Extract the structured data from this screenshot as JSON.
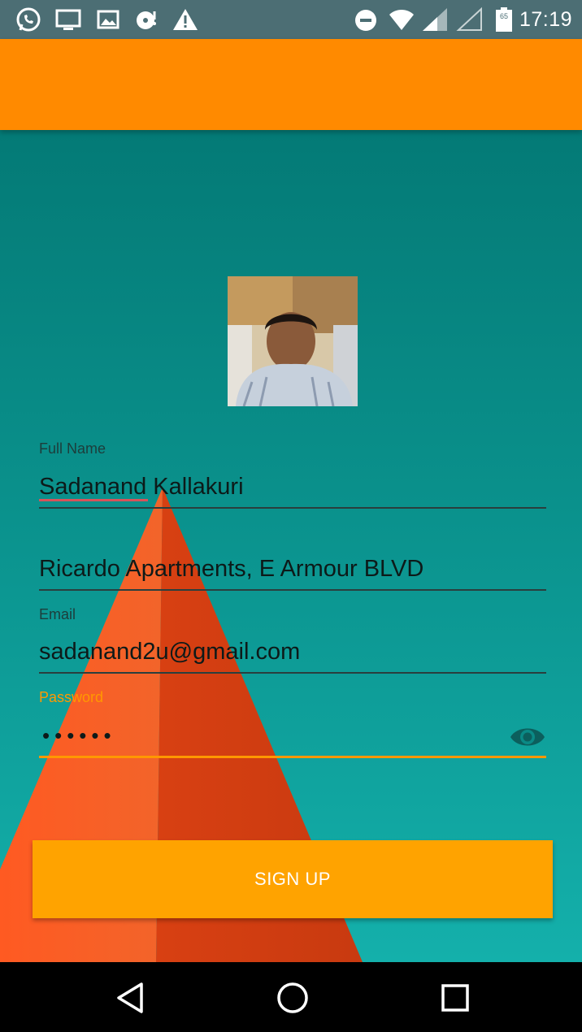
{
  "status_bar": {
    "time": "17:19",
    "left_icons": [
      "whatsapp-icon",
      "cast-display-icon",
      "image-icon",
      "sync-disc-icon",
      "warning-icon"
    ],
    "right_icons": [
      "do-not-disturb-icon",
      "wifi-icon",
      "cell-signal-icon",
      "cell-signal-empty-icon",
      "battery-icon"
    ],
    "battery_level": "65"
  },
  "form": {
    "full_name": {
      "label": "Full Name",
      "value": "Sadanand Kallakuri"
    },
    "address": {
      "value": "Ricardo Apartments, E Armour BLVD"
    },
    "email": {
      "label": "Email",
      "value": "sadanand2u@gmail.com"
    },
    "password": {
      "label": "Password",
      "value": "••••••"
    },
    "signup_label": "SIGN UP"
  },
  "colors": {
    "app_bar": "#ff8a00",
    "status_bar": "#4c6e74",
    "accent": "#ff9800",
    "button": "#ffa300",
    "background": "#0a8a86"
  }
}
